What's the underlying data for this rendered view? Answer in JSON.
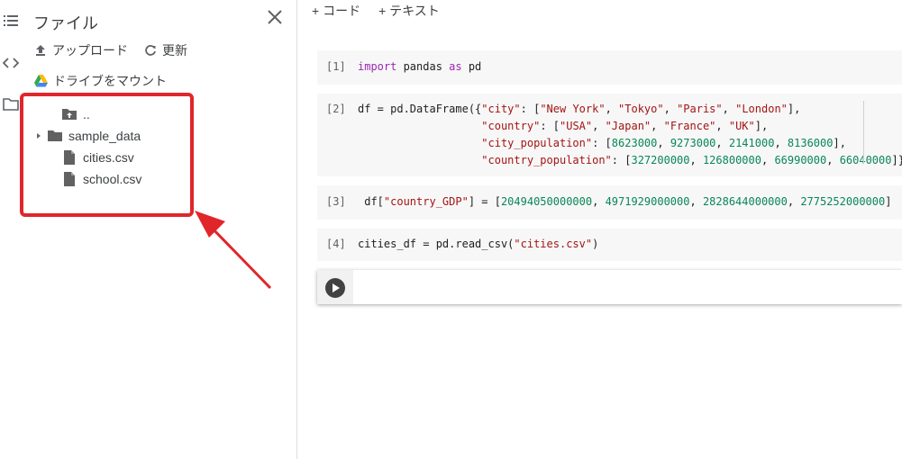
{
  "sidebar": {
    "title": "ファイル",
    "upload_label": "アップロード",
    "refresh_label": "更新",
    "mount_drive_label": "ドライブをマウント",
    "files": [
      {
        "name": "..",
        "icon": "folder-up-icon"
      },
      {
        "name": "sample_data",
        "icon": "folder-icon",
        "expandable": true
      },
      {
        "name": "cities.csv",
        "icon": "file-icon"
      },
      {
        "name": "school.csv",
        "icon": "file-icon"
      }
    ]
  },
  "toolbar": {
    "add_code_label": "+ コード",
    "add_text_label": "+ テキスト"
  },
  "cells": [
    {
      "number": "[1]",
      "code": "import pandas as pd"
    },
    {
      "number": "[2]",
      "code": "df = pd.DataFrame({\"city\": [\"New York\", \"Tokyo\", \"Paris\", \"London\"],\n                   \"country\": [\"USA\", \"Japan\", \"France\", \"UK\"],\n                   \"city_population\": [8623000, 9273000, 2141000, 8136000],\n                   \"country_population\": [327200000, 126800000, 66990000, 66040000]})"
    },
    {
      "number": "[3]",
      "code": " df[\"country_GDP\"] = [20494050000000, 4971929000000, 2828644000000, 2775252000000]"
    },
    {
      "number": "[4]",
      "code": "cities_df = pd.read_csv(\"cities.csv\")"
    }
  ],
  "colors": {
    "highlight": "#e0262b",
    "keyword": "#9c27b0",
    "string": "#a31515",
    "number": "#098658"
  }
}
